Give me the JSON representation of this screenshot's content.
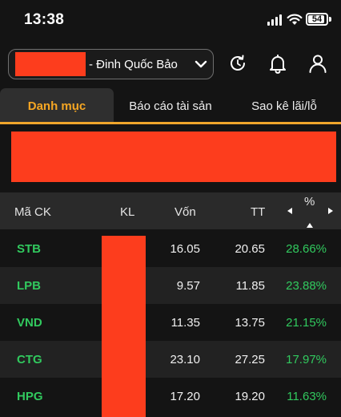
{
  "status_bar": {
    "time": "13:38",
    "battery": "54"
  },
  "header": {
    "account_name": "- Đinh Quốc Bảo",
    "icons": [
      "refresh-icon",
      "bell-icon",
      "user-icon"
    ]
  },
  "tabs": [
    {
      "label": "Danh mục",
      "active": true
    },
    {
      "label": "Báo cáo tài sản",
      "active": false
    },
    {
      "label": "Sao kê lãi/lỗ",
      "active": false
    }
  ],
  "table": {
    "headers": {
      "symbol": "Mã CK",
      "kl": "KL",
      "von": "Vốn",
      "tt": "TT",
      "pct": "%"
    },
    "rows": [
      {
        "symbol": "STB",
        "von": "16.05",
        "tt": "20.65",
        "pct": "28.66%"
      },
      {
        "symbol": "LPB",
        "von": "9.57",
        "tt": "11.85",
        "pct": "23.88%"
      },
      {
        "symbol": "VND",
        "von": "11.35",
        "tt": "13.75",
        "pct": "21.15%"
      },
      {
        "symbol": "CTG",
        "von": "23.10",
        "tt": "27.25",
        "pct": "17.97%"
      },
      {
        "symbol": "HPG",
        "von": "17.20",
        "tt": "19.20",
        "pct": "11.63%"
      }
    ]
  },
  "colors": {
    "accent": "#f0a62c",
    "positive": "#31c95e",
    "redaction": "#fd3d1d",
    "background": "#141414"
  }
}
